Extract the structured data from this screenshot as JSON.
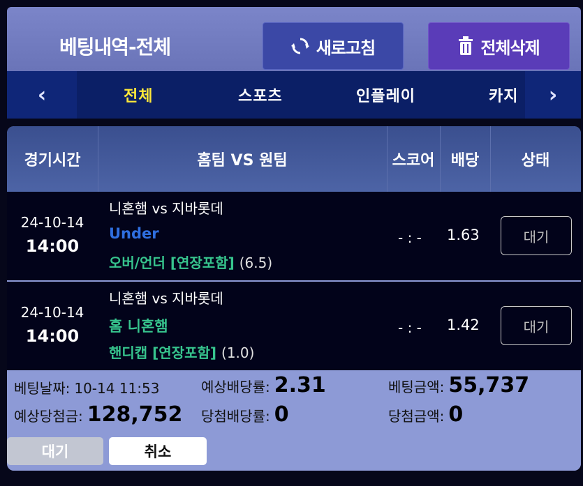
{
  "header": {
    "title": "베팅내역-전체",
    "refresh_label": "새로고침",
    "delete_all_label": "전체삭제"
  },
  "tabs": {
    "prev_icon": "‹",
    "next_icon": "›",
    "items": [
      {
        "label": "전체",
        "active": true
      },
      {
        "label": "스포츠",
        "active": false
      },
      {
        "label": "인플레이",
        "active": false
      },
      {
        "label": "카지",
        "active": false
      }
    ]
  },
  "table": {
    "columns": [
      "경기시간",
      "홈팀 VS 원팀",
      "스코어",
      "배당",
      "상태"
    ],
    "rows": [
      {
        "date": "24-10-14",
        "time": "14:00",
        "teams": "니혼햄 vs 지바롯데",
        "pick": "Under",
        "pick_color": "#2f6fe0",
        "market": "오버/언더 [연장포함]",
        "line": "(6.5)",
        "score": "- : -",
        "odds": "1.63",
        "status": "대기"
      },
      {
        "date": "24-10-14",
        "time": "14:00",
        "teams": "니혼햄 vs 지바롯데",
        "pick": "홈 니혼햄",
        "pick_color": "#37c58e",
        "market": "핸디캡 [연장포함]",
        "line": "(1.0)",
        "score": "- : -",
        "odds": "1.42",
        "status": "대기"
      }
    ]
  },
  "summary": {
    "bet_date_label": "베팅날짜:",
    "bet_date_value": "10-14 11:53",
    "expected_odds_label": "예상배당률:",
    "expected_odds_value": "2.31",
    "bet_amount_label": "베팅금액:",
    "bet_amount_value": "55,737",
    "expected_win_label": "예상당첨금:",
    "expected_win_value": "128,752",
    "win_odds_label": "당첨배당률:",
    "win_odds_value": "0",
    "win_amount_label": "당첨금액:",
    "win_amount_value": "0"
  },
  "actions": {
    "wait_label": "대기",
    "cancel_label": "취소"
  },
  "colors": {
    "accent_yellow": "#ffe83a",
    "header_bg": "#7b85c9",
    "tab_bg": "#0b1f66",
    "refresh_bg": "#3b48a6",
    "delete_bg": "#5a3cb8"
  }
}
